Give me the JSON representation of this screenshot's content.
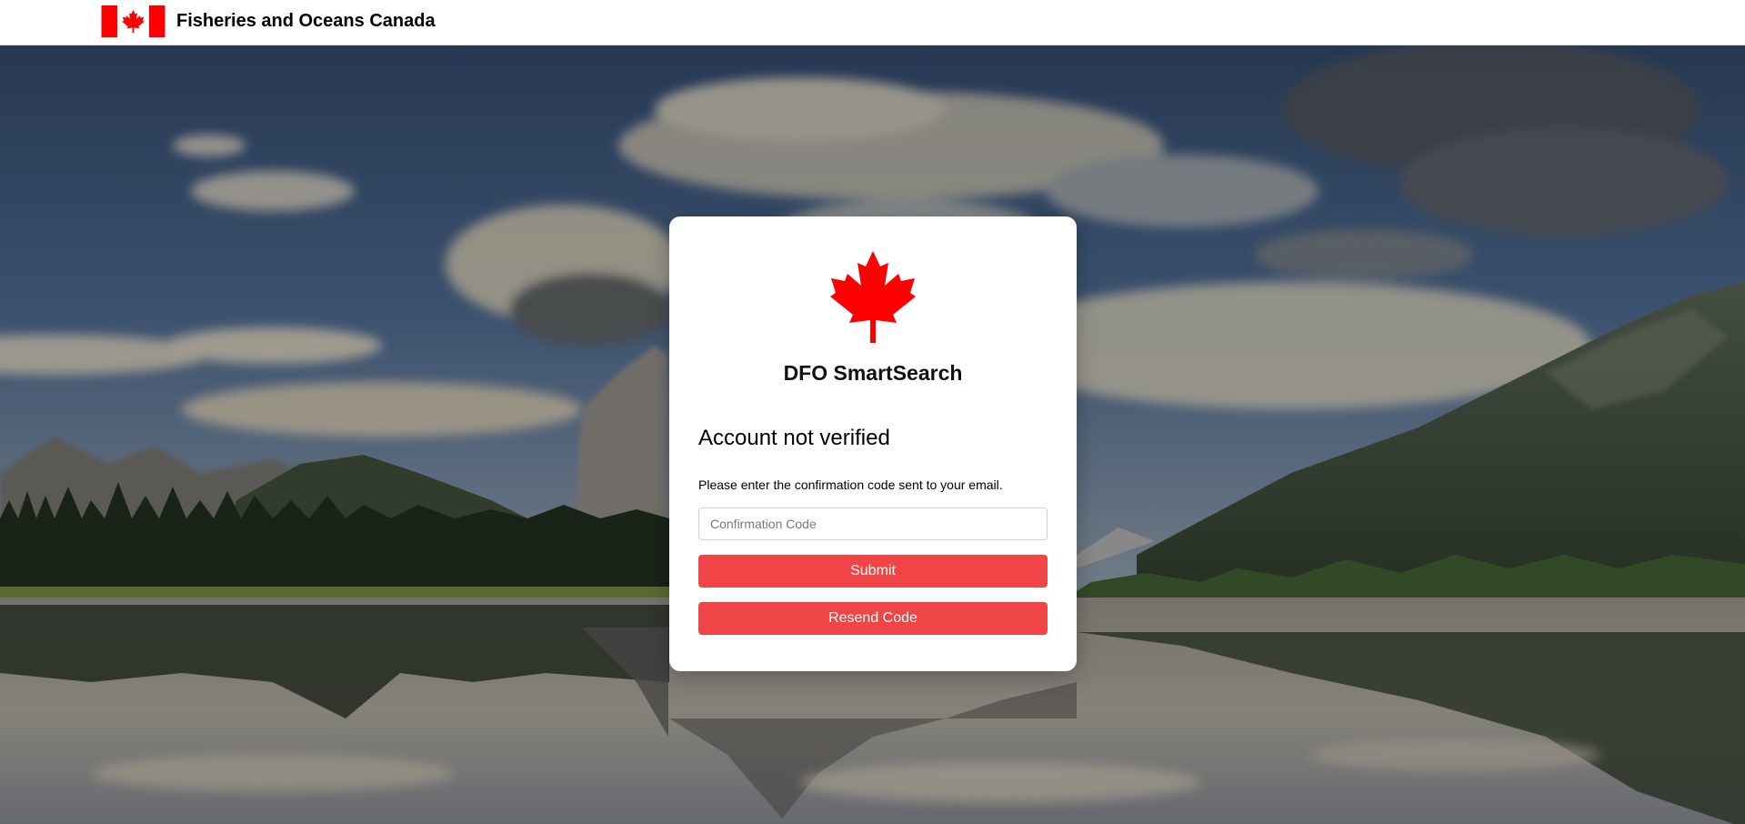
{
  "header": {
    "department_name": "Fisheries and Oceans Canada",
    "flag_icon": "canada-flag-icon"
  },
  "card": {
    "logo_icon": "maple-leaf-icon",
    "app_title": "DFO SmartSearch",
    "heading": "Account not verified",
    "instruction": "Please enter the confirmation code sent to your email.",
    "code_input": {
      "placeholder": "Confirmation Code",
      "value": ""
    },
    "submit_label": "Submit",
    "resend_label": "Resend Code"
  },
  "colors": {
    "accent_red": "#ef4546",
    "flag_red": "#ff0000",
    "card_bg": "#ffffff"
  }
}
